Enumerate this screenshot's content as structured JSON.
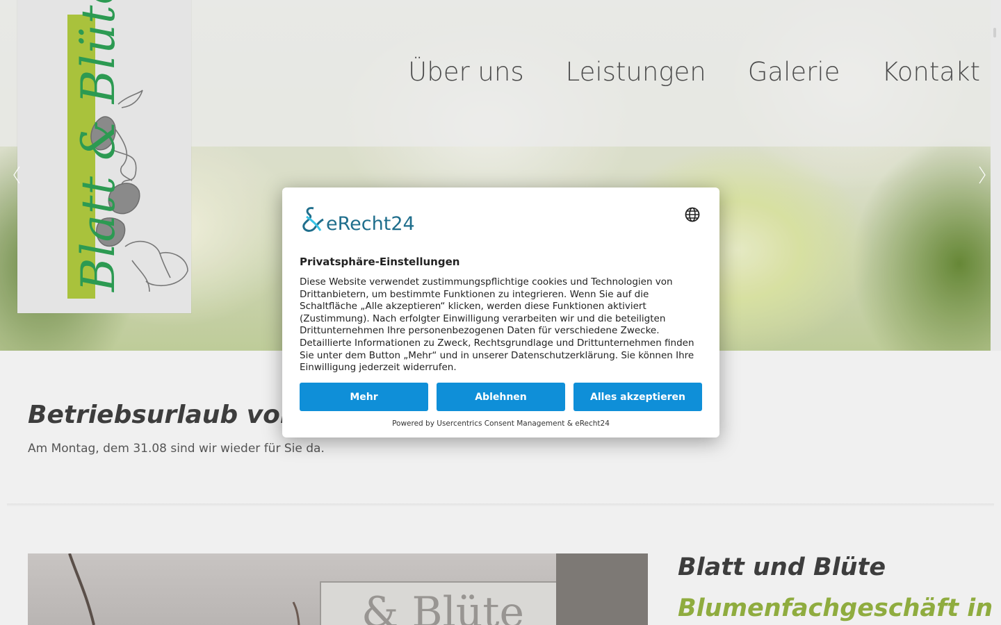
{
  "brand": {
    "logo_text": "Blatt & Blüte",
    "accent_green": "#a9c23c",
    "logo_green": "#2c9a52"
  },
  "nav": {
    "items": [
      {
        "label": "Über uns"
      },
      {
        "label": "Leistungen"
      },
      {
        "label": "Galerie"
      },
      {
        "label": "Kontakt"
      }
    ]
  },
  "slider": {
    "prev_icon": "chevron-left-icon",
    "next_icon": "chevron-right-icon"
  },
  "notice": {
    "title": "Betriebsurlaub vom",
    "text": "Am Montag, dem 31.08 sind wir wieder für Sie da."
  },
  "about": {
    "photo_sign_text": "& Blüte",
    "title": "Blatt und Blüte",
    "subtitle": "Blumenfachgeschäft in",
    "subtitle_color": "#8fac3f"
  },
  "consent": {
    "logo_text": "eRecht24",
    "language_icon": "globe-icon",
    "title": "Privatsphäre-Einstellungen",
    "body": "Diese Website verwendet zustimmungspflichtige cookies und Technologien von Drittanbietern, um bestimmte Funktionen zu integrieren. Wenn Sie auf die Schaltfläche „Alle akzeptieren“ klicken, werden diese Funktionen aktiviert (Zustimmung). Nach erfolgter Einwilligung verarbeiten wir und die beteiligten Drittunternehmen Ihre personenbezogenen Daten für verschiedene Zwecke. Detaillierte Informationen zu Zweck, Rechtsgrundlage und Drittunternehmen finden Sie unter dem Button „Mehr“ und in unserer Datenschutzerklärung. Sie können Ihre Einwilligung jederzeit widerrufen.",
    "buttons": {
      "more": "Mehr",
      "decline": "Ablehnen",
      "accept": "Alles akzeptieren"
    },
    "button_color": "#0f8fd8",
    "footer": "Powered by Usercentrics Consent Management & eRecht24"
  }
}
